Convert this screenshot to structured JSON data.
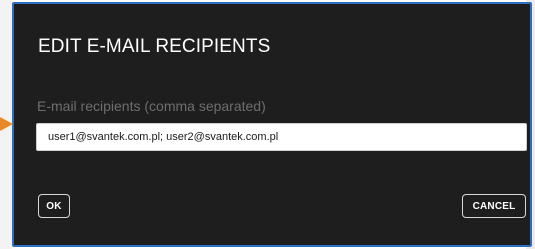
{
  "dialog": {
    "title": "EDIT E-MAIL RECIPIENTS",
    "recipients_label": "E-mail recipients (comma separated)",
    "recipients_value": "user1@svantek.com.pl; user2@svantek.com.pl",
    "ok_label": "OK",
    "cancel_label": "CANCEL"
  },
  "colors": {
    "dialog_background": "#1e1e1e",
    "dialog_border": "#2f6fbf",
    "label_text": "#6e6e6e",
    "pointer_arrow": "#e8892a"
  },
  "icons": {
    "pointer": "arrow-right-icon"
  }
}
